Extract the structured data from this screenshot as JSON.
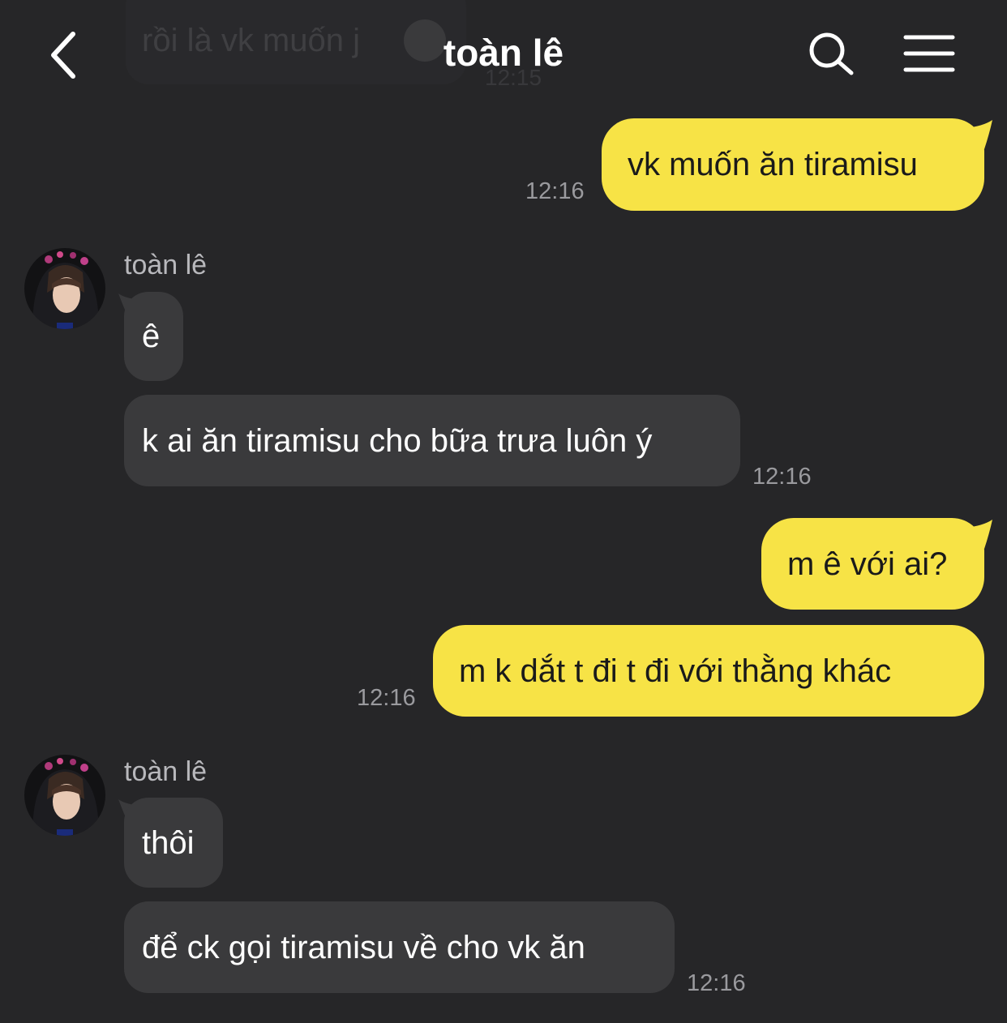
{
  "header": {
    "title": "toàn lê",
    "back_icon": "chevron-left-icon",
    "search_icon": "search-icon",
    "menu_icon": "menu-icon"
  },
  "previous_message": {
    "text": "rồi là vk muốn j",
    "time": "12:15"
  },
  "messages": [
    {
      "direction": "out",
      "text": "vk muốn ăn tiramisu",
      "time": "12:16"
    },
    {
      "direction": "in",
      "sender": "toàn lê",
      "text": "ê"
    },
    {
      "direction": "in",
      "text": "k ai ăn tiramisu cho bữa trưa luôn ý",
      "time": "12:16"
    },
    {
      "direction": "out",
      "text": "m ê với ai?"
    },
    {
      "direction": "out",
      "text": "m k dắt t đi t đi với thằng khác",
      "time": "12:16"
    },
    {
      "direction": "in",
      "sender": "toàn lê",
      "text": "thôi"
    },
    {
      "direction": "in",
      "text": "để ck gọi tiramisu về cho vk ăn",
      "time": "12:16"
    }
  ],
  "colors": {
    "background": "#262628",
    "outgoing_bubble": "#f7e346",
    "incoming_bubble": "#3a3a3c",
    "timestamp": "#9a9a9e"
  }
}
